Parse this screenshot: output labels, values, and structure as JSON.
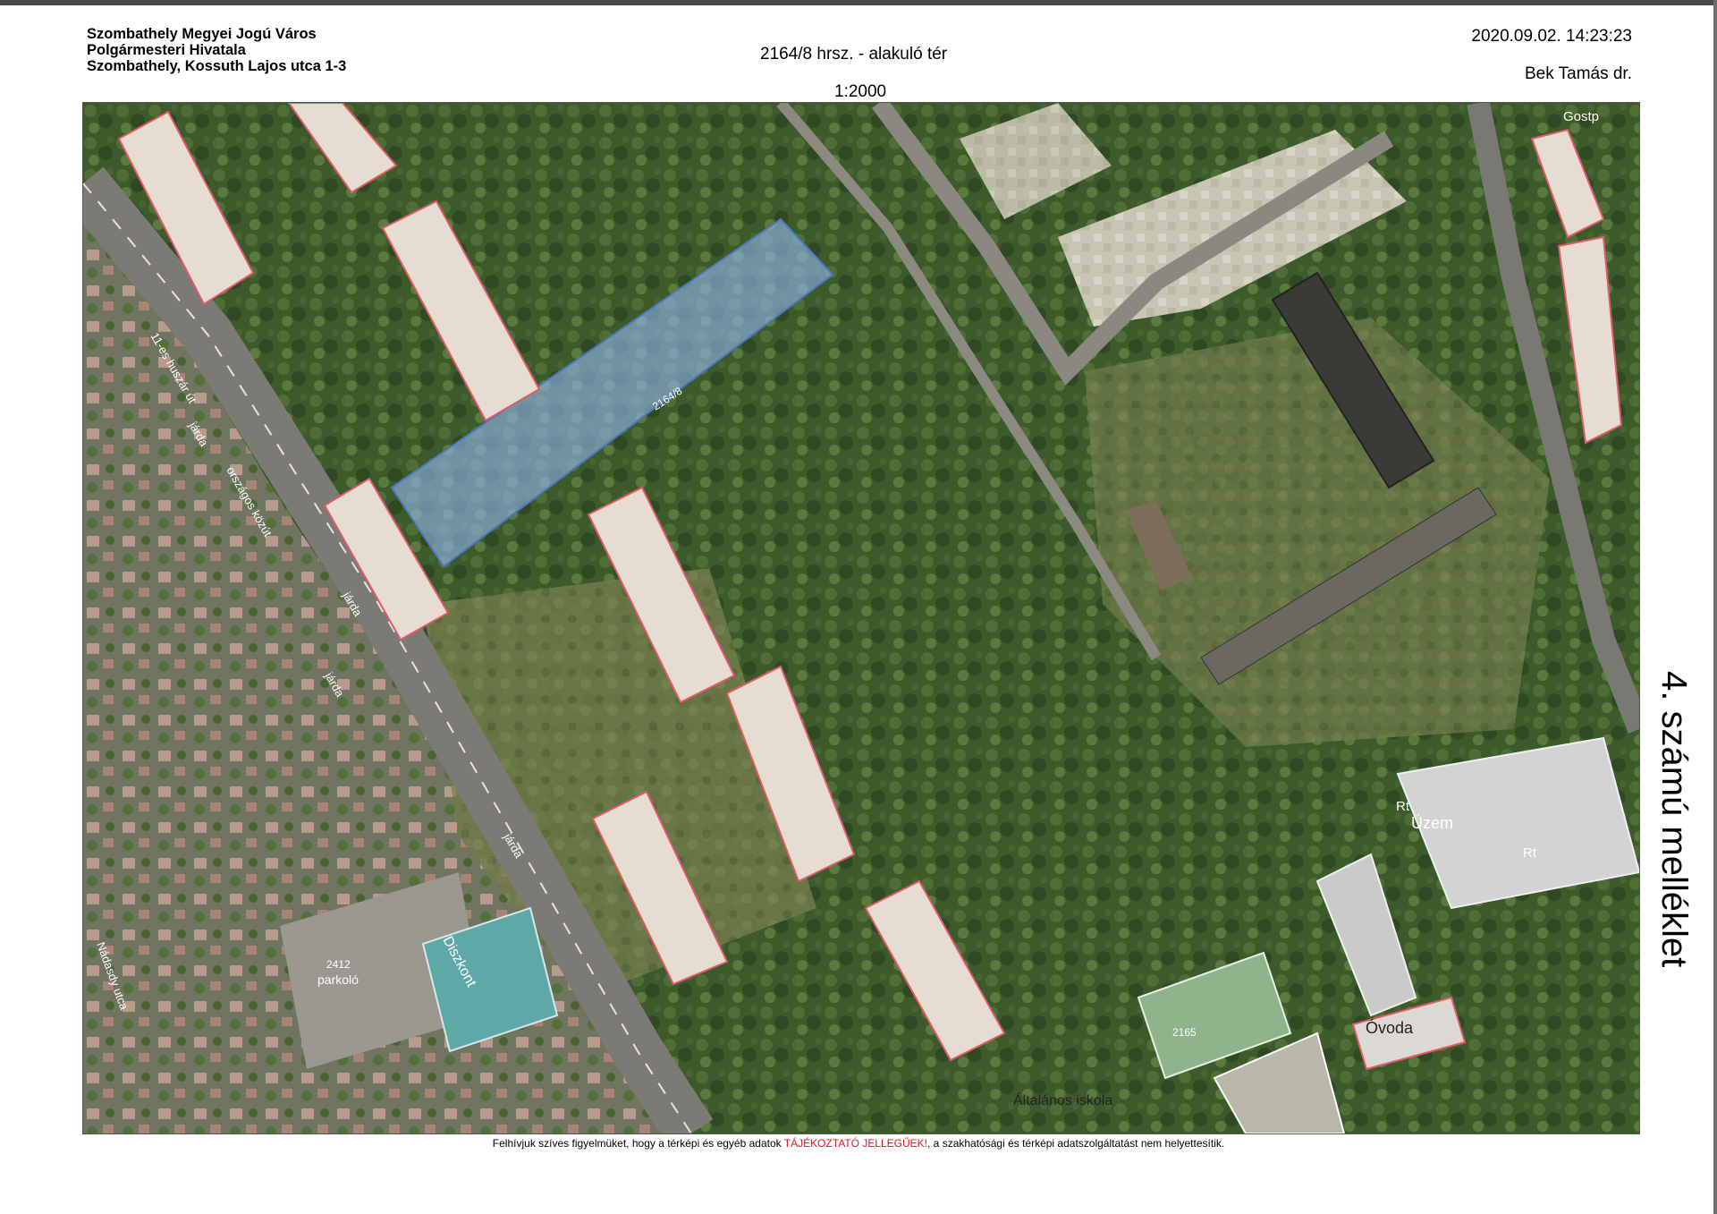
{
  "header": {
    "org_line1": "Szombathely Megyei Jogú Város",
    "org_line2": "Polgármesteri Hivatala",
    "org_line3": "Szombathely, Kossuth Lajos utca 1-3",
    "title": "2164/8 hrsz. - alakuló tér",
    "scale": "1:2000",
    "timestamp": "2020.09.02. 14:23:23",
    "author": "Bek Tamás dr."
  },
  "side_label": "4. számú melléklet",
  "footer": {
    "prefix": "Felhívjuk szíves figyelmüket, hogy a térképi és egyéb adatok ",
    "warning": "TÁJÉKOZTATÓ JELLEGŰEK!",
    "suffix": ", a szakhatósági és térképi adatszolgáltatást nem helyettesítik."
  },
  "map": {
    "colors": {
      "vegetation": "#3f5a2a",
      "highlight": "#8fb4ea",
      "parcel_line": "#e05a6a",
      "road": "#7c7a74",
      "roof": "#e6dcd2"
    },
    "labels": {
      "parcel_main": "2164/8",
      "uzem": "Üzem",
      "ovoda": "Óvoda",
      "iskola": "Általános iskola",
      "diszkont": "Diszkont",
      "parkolo": "parkoló",
      "parcel_2165": "2165",
      "parcel_2412": "2412",
      "jarda_1": "járda",
      "jarda_2": "járda",
      "jarda_3": "járda",
      "jarda_4": "járda",
      "street_honved": "11-es huszár út",
      "street_orszagos": "országos közút",
      "street_nadasdy": "Nádasdy utca",
      "rt_1": "Rt",
      "rt_2": "Rt",
      "corner": "Gostp"
    }
  }
}
